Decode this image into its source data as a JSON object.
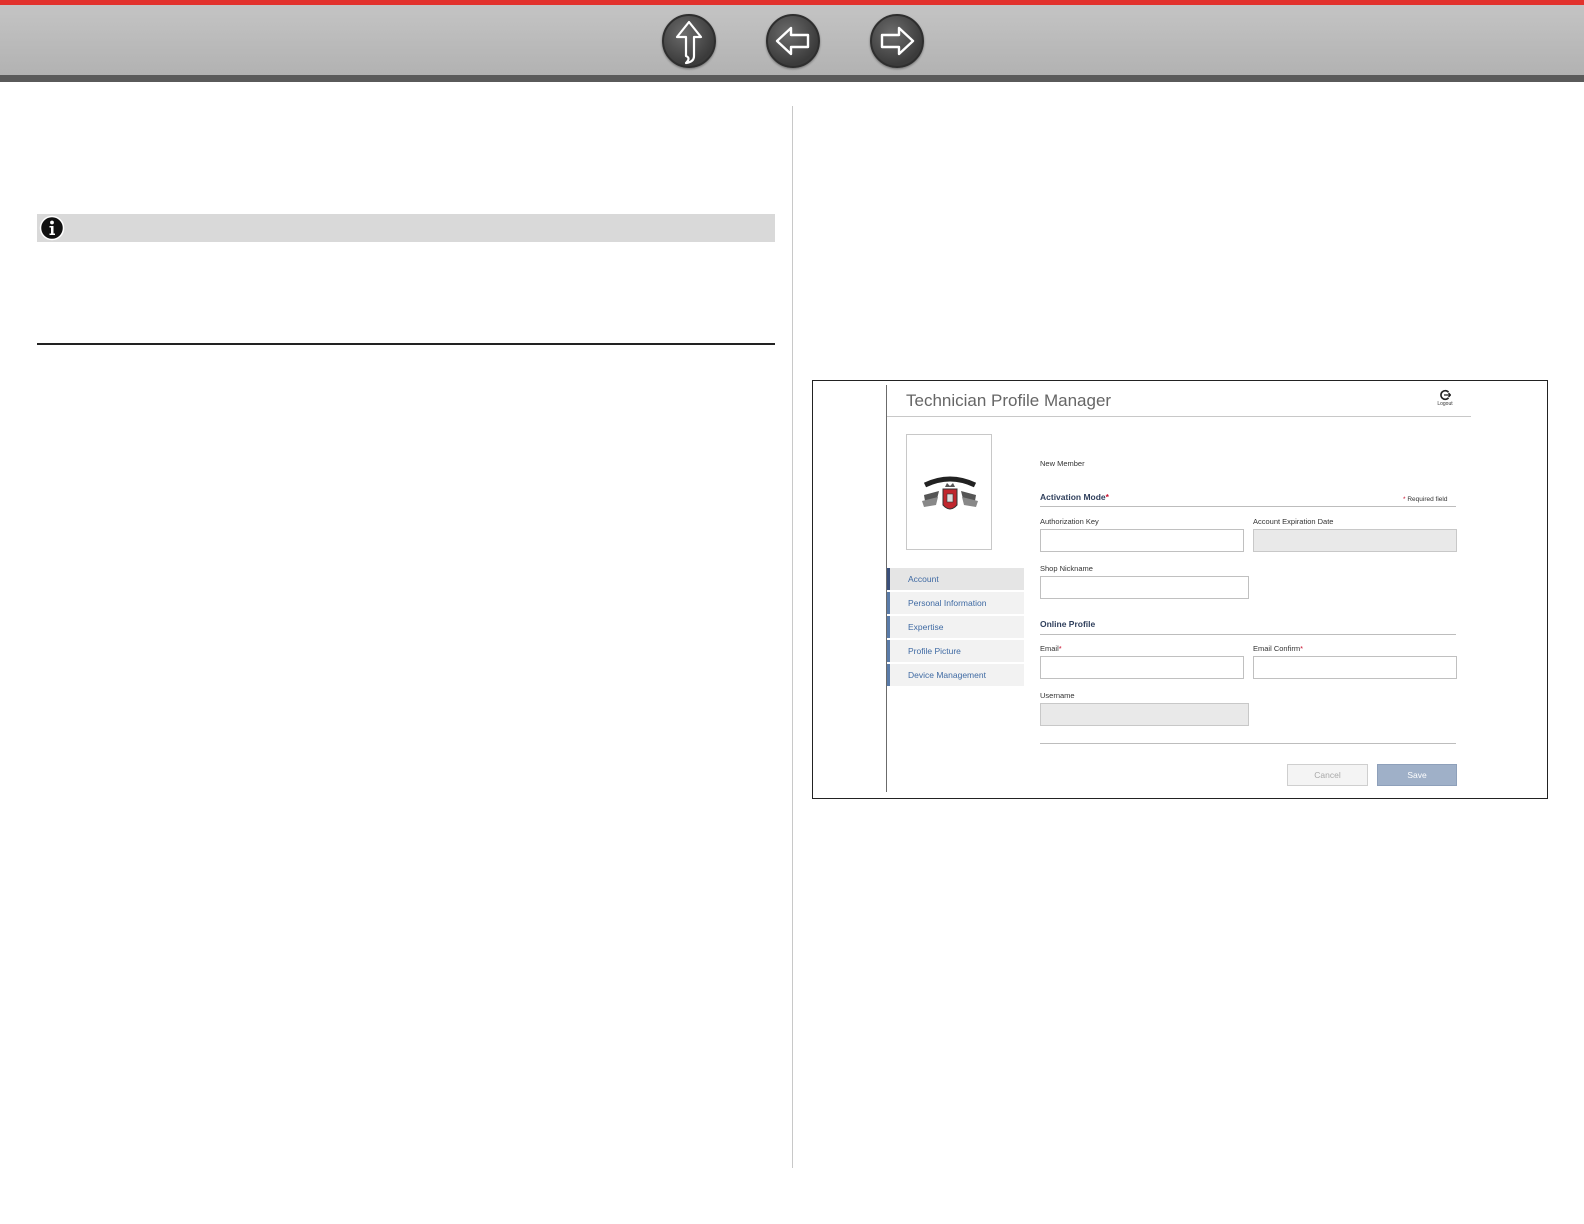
{
  "nav": {
    "up_icon": "up-arrow-icon",
    "back_icon": "left-arrow-icon",
    "forward_icon": "right-arrow-icon",
    "accent_color": "#e2322d"
  },
  "note": {
    "icon": "info-icon"
  },
  "app": {
    "title": "Technician Profile Manager",
    "logout_label": "Logout",
    "profile_picture_icon": "performance-is-king-logo",
    "sidebar": [
      {
        "label": "Account",
        "active": true
      },
      {
        "label": "Personal Information",
        "active": false
      },
      {
        "label": "Expertise",
        "active": false
      },
      {
        "label": "Profile Picture",
        "active": false
      },
      {
        "label": "Device Management",
        "active": false
      }
    ],
    "form": {
      "status": "New Member",
      "activation_section": "Activation Mode",
      "required_star": "*",
      "required_note": "Required field",
      "authorization_key": {
        "label": "Authorization Key",
        "value": ""
      },
      "account_expiration_date": {
        "label": "Account Expiration Date",
        "value": ""
      },
      "shop_nickname": {
        "label": "Shop Nickname",
        "value": ""
      },
      "online_section": "Online Profile",
      "email": {
        "label": "Email",
        "value": ""
      },
      "email_confirm": {
        "label": "Email Confirm",
        "value": ""
      },
      "username": {
        "label": "Username",
        "value": ""
      },
      "cancel_label": "Cancel",
      "save_label": "Save"
    }
  }
}
